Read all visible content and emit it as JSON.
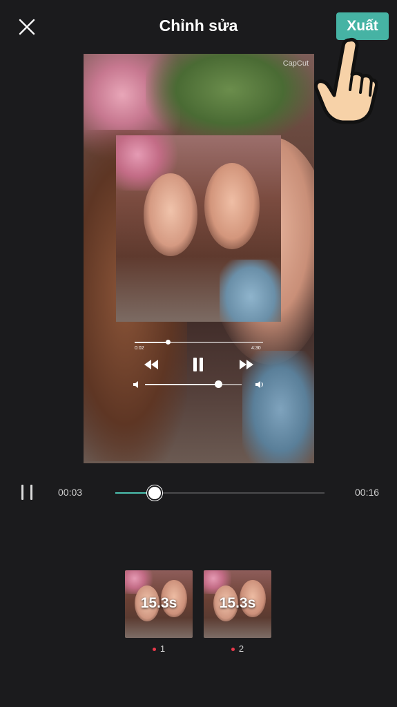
{
  "header": {
    "title": "Chỉnh sửa",
    "export_label": "Xuất"
  },
  "preview": {
    "watermark": "CapCut"
  },
  "media_player": {
    "current_time": "0:02",
    "total_time": "4:30",
    "progress": 0.26,
    "volume": 0.76
  },
  "playback": {
    "current_time": "00:03",
    "total_time": "00:16",
    "progress": 0.18
  },
  "clips": [
    {
      "duration": "15.3s",
      "label": "1"
    },
    {
      "duration": "15.3s",
      "label": "2"
    }
  ],
  "colors": {
    "accent": "#46b3a4",
    "track_fill": "#4cc2b0",
    "background": "#1b1b1d",
    "dot": "#e9394b"
  },
  "icons": {
    "close": "close-icon",
    "pointer": "hand-pointer-icon",
    "pause": "pause-icon"
  }
}
